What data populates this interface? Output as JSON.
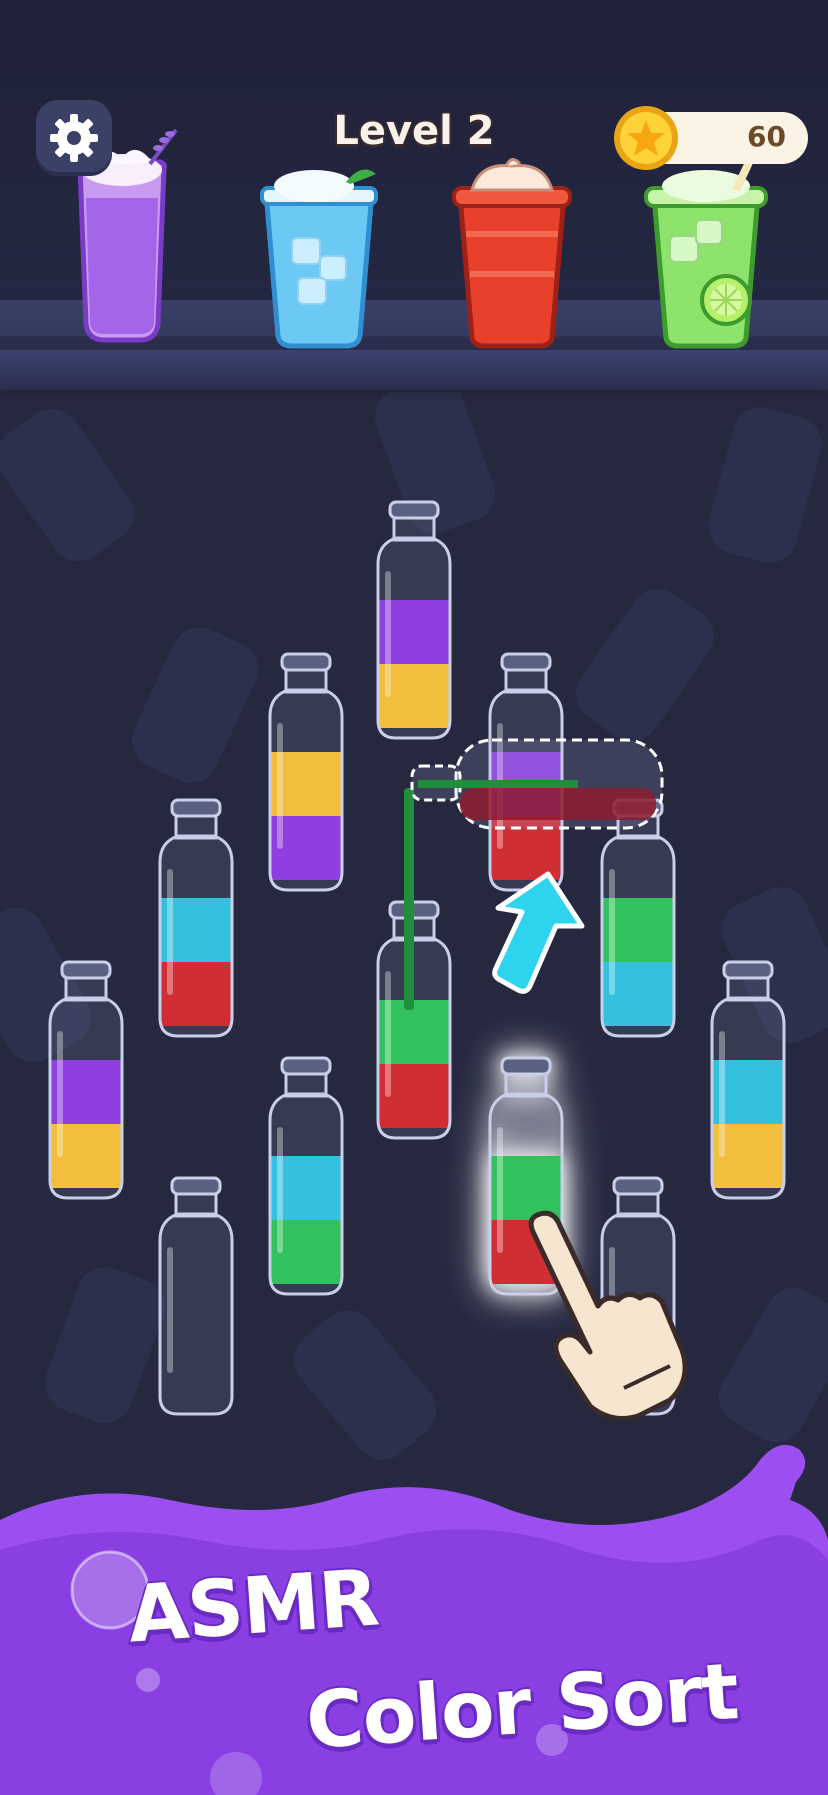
{
  "header": {
    "level_label": "Level 2",
    "coin_count": "60"
  },
  "icons": {
    "settings": "gear-icon",
    "coin": "star-coin-icon",
    "hint": "arrow-up-icon",
    "tutorial_hand": "pointing-hand-icon"
  },
  "drinks": [
    "lavender-milk-drink",
    "iced-water-drink",
    "strawberry-cream-drink",
    "lime-mojito-drink"
  ],
  "colors": {
    "purple": "#8a2de0",
    "yellow": "#fbbf24",
    "cyan": "#22c2dc",
    "red": "#d31b1b",
    "green": "#22c24a",
    "accent_purple": "#8b3fe3"
  },
  "bottles": [
    {
      "id": "bottle-1",
      "layers": [
        "yellow",
        "purple"
      ]
    },
    {
      "id": "bottle-2",
      "layers": [
        "purple",
        "yellow"
      ]
    },
    {
      "id": "bottle-3",
      "layers": [
        "red",
        "purple"
      ]
    },
    {
      "id": "bottle-4",
      "layers": [
        "red",
        "cyan"
      ]
    },
    {
      "id": "bottle-5",
      "layers": [
        "red",
        "green"
      ]
    },
    {
      "id": "bottle-6",
      "layers": [
        "green",
        "cyan"
      ]
    },
    {
      "id": "bottle-7",
      "layers": [
        "yellow",
        "purple"
      ]
    },
    {
      "id": "bottle-8",
      "layers": [
        "cyan",
        "green"
      ]
    },
    {
      "id": "bottle-9",
      "layers": []
    },
    {
      "id": "bottle-10",
      "layers": [
        "red",
        "green"
      ],
      "selected": true
    },
    {
      "id": "bottle-11",
      "layers": []
    },
    {
      "id": "bottle-12",
      "layers": [
        "yellow",
        "cyan"
      ]
    }
  ],
  "tilted_bottle": {
    "layers": [
      "red"
    ]
  },
  "banner": {
    "line1": "ASMR",
    "line2": "Color Sort"
  }
}
